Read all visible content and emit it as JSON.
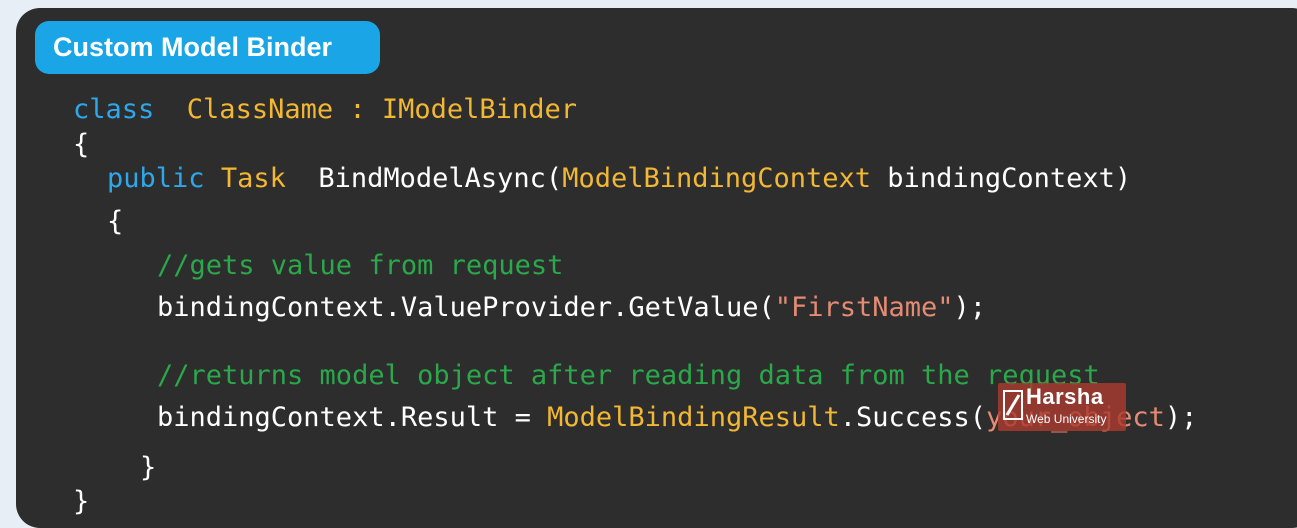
{
  "title": "Custom Model Binder",
  "code_lines": [
    {
      "tokens": [
        {
          "t": "class",
          "c": "keyword"
        },
        {
          "t": "  ",
          "c": "plain"
        },
        {
          "t": "ClassName",
          "c": "type"
        },
        {
          "t": " : ",
          "c": "type"
        },
        {
          "t": "IModelBinder",
          "c": "type"
        }
      ]
    },
    {
      "tokens": [
        {
          "t": "{",
          "c": "plain"
        }
      ]
    },
    {
      "tokens": [
        {
          "t": "public",
          "c": "keyword"
        },
        {
          "t": " ",
          "c": "plain"
        },
        {
          "t": "Task",
          "c": "type"
        },
        {
          "t": "  BindModelAsync(",
          "c": "plain"
        },
        {
          "t": "ModelBindingContext",
          "c": "type"
        },
        {
          "t": " bindingContext)",
          "c": "plain"
        }
      ]
    },
    {
      "tokens": [
        {
          "t": "{",
          "c": "plain"
        }
      ]
    },
    {
      "tokens": [
        {
          "t": "//gets value from request",
          "c": "comment"
        }
      ]
    },
    {
      "tokens": [
        {
          "t": "bindingContext.ValueProvider.GetValue(",
          "c": "plain"
        },
        {
          "t": "\"FirstName\"",
          "c": "string"
        },
        {
          "t": ");",
          "c": "plain"
        }
      ]
    },
    {
      "tokens": [
        {
          "t": "//returns model object after reading data from the request",
          "c": "comment"
        }
      ]
    },
    {
      "tokens": [
        {
          "t": "bindingContext.Result = ",
          "c": "plain"
        },
        {
          "t": "ModelBindingResult",
          "c": "type"
        },
        {
          "t": ".Success(",
          "c": "plain"
        },
        {
          "t": "your_object",
          "c": "string"
        },
        {
          "t": ");",
          "c": "plain"
        }
      ]
    },
    {
      "tokens": [
        {
          "t": "}",
          "c": "plain"
        }
      ]
    },
    {
      "tokens": [
        {
          "t": "}",
          "c": "plain"
        }
      ]
    }
  ],
  "watermark": {
    "name": "Harsha",
    "subtitle": "Web University"
  },
  "colors": {
    "keyword": "#2ea8ec",
    "type": "#f2b733",
    "comment": "#2aa84a",
    "string": "#e58b74",
    "plain": "#ffffff",
    "title_pill": "#19a5e6",
    "panel": "#2d2d2d"
  }
}
